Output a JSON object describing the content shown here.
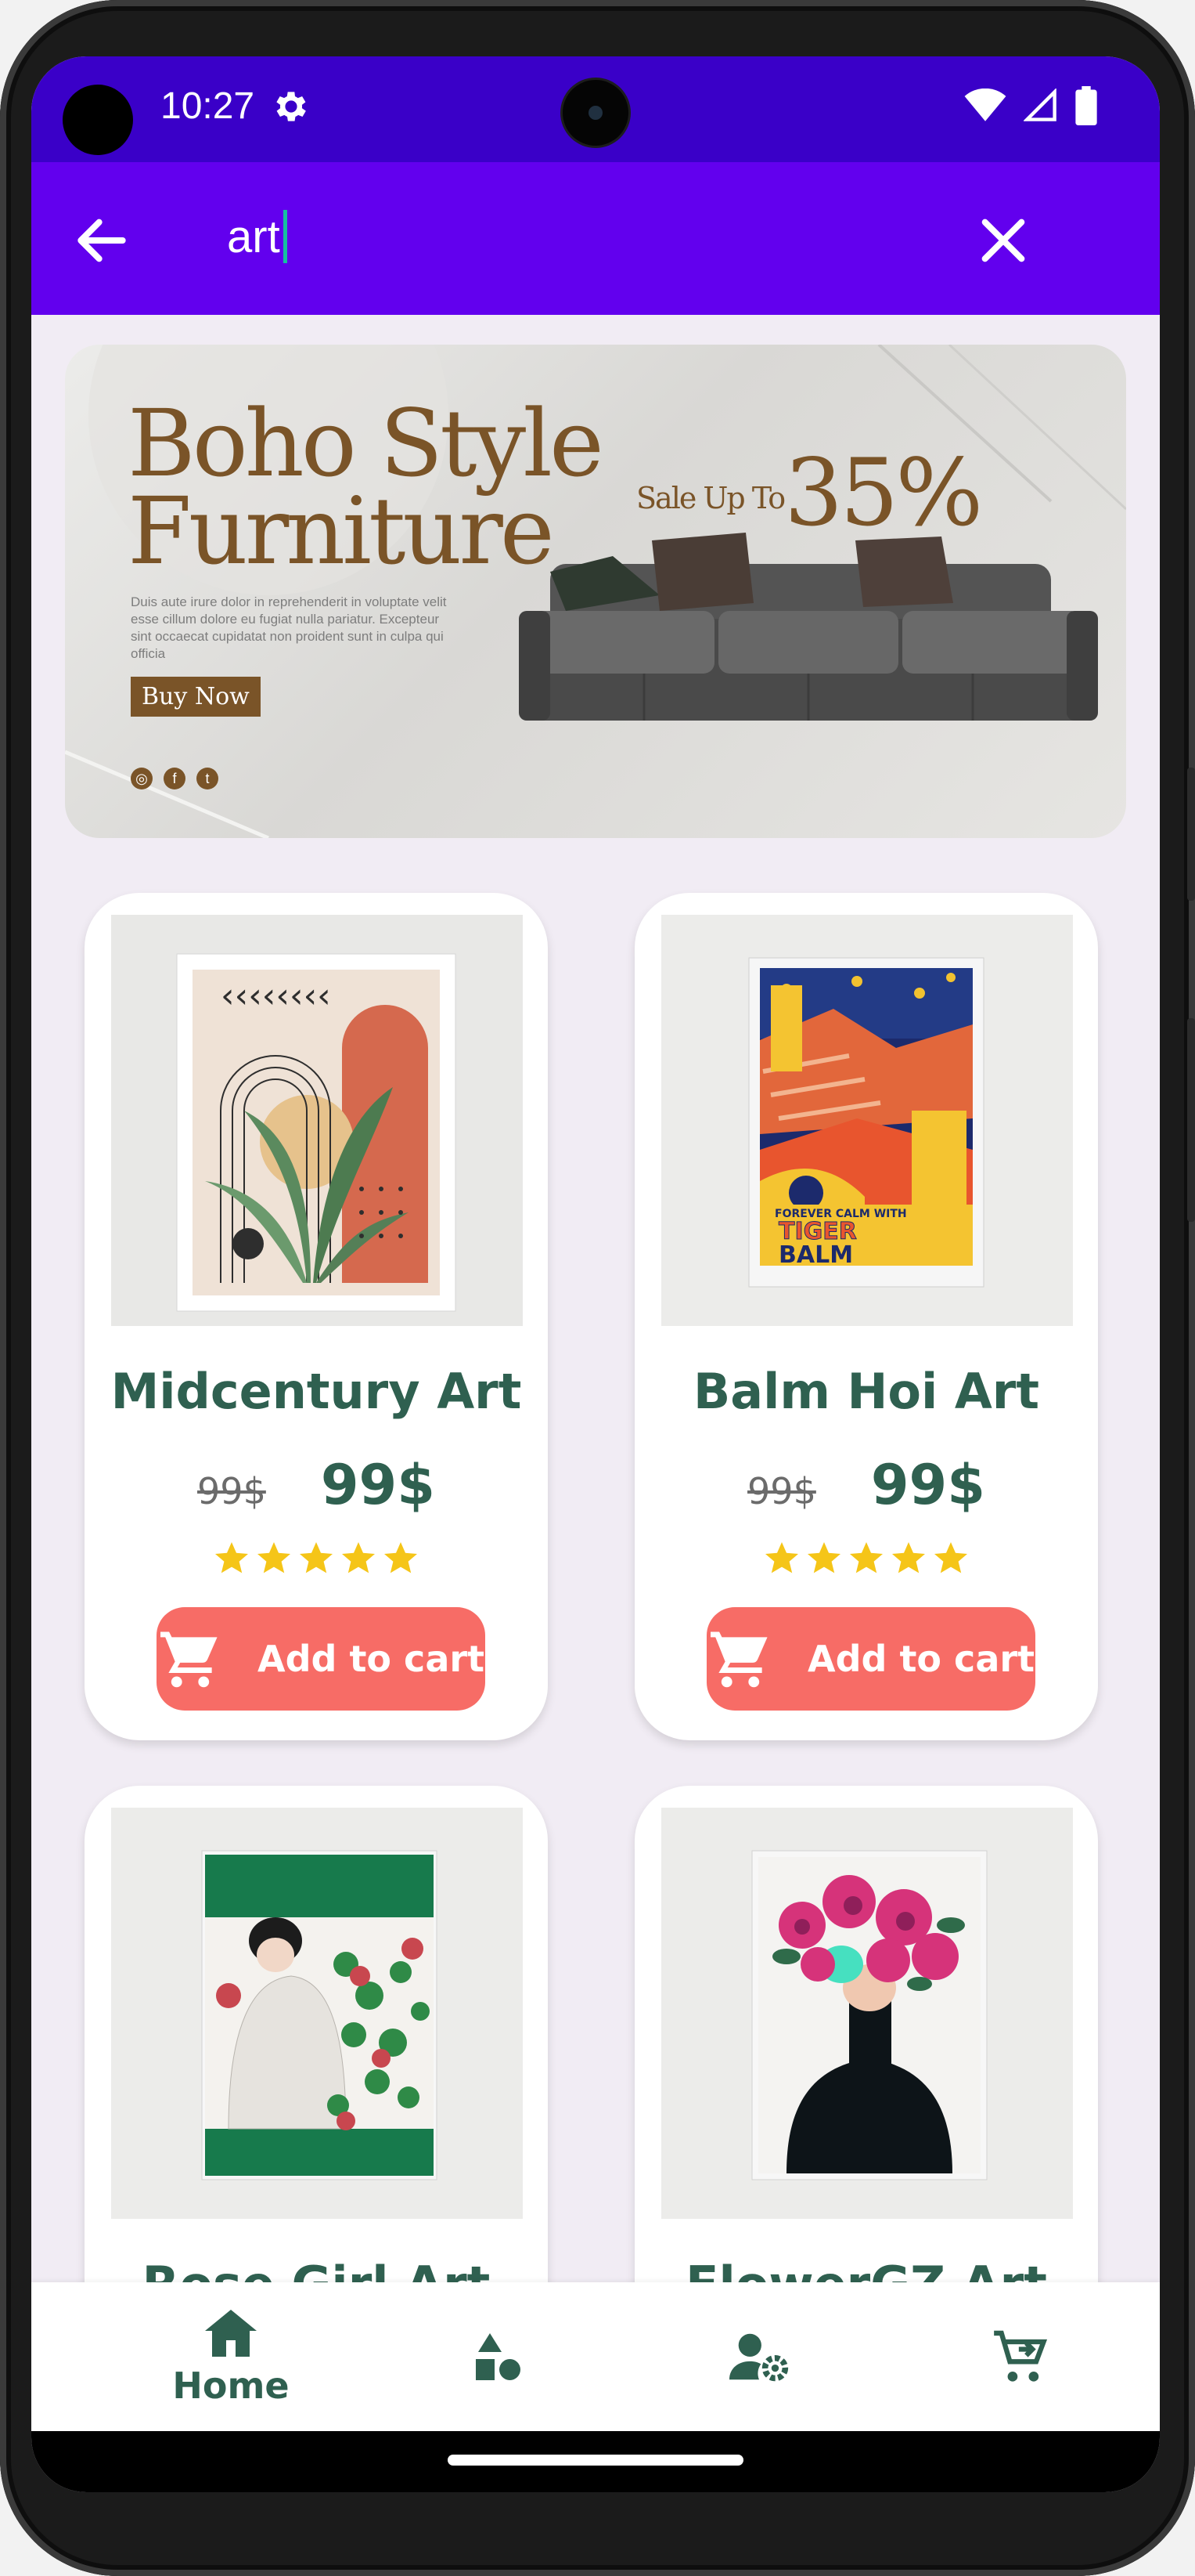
{
  "status_bar": {
    "time": "10:27"
  },
  "search": {
    "query": "art"
  },
  "banner": {
    "title_line1": "Boho Style",
    "title_line2": "Furniture",
    "description": "Duis aute irure dolor in reprehenderit in voluptate velit esse cillum dolore eu fugiat nulla pariatur. Excepteur sint occaecat cupidatat non proident sunt in culpa qui officia",
    "sale_text": "Sale Up To",
    "sale_percent": "35%",
    "cta": "Buy Now"
  },
  "products": [
    {
      "name": "Midcentury Art",
      "old_price": "99$",
      "price": "99$",
      "rating": 5,
      "button": "Add to cart"
    },
    {
      "name": "Balm Hoi Art",
      "old_price": "99$",
      "price": "99$",
      "rating": 5,
      "button": "Add to cart"
    },
    {
      "name": "Rose Girl Art"
    },
    {
      "name": "FlowerGZ Art"
    }
  ],
  "poster": {
    "top_line": "FOREVER CALM WITH",
    "line1": "TIGER",
    "line2": "BALM"
  },
  "bottom_nav": {
    "items": [
      {
        "label": "Home",
        "icon": "home-icon",
        "active": true
      },
      {
        "label": "",
        "icon": "categories-icon"
      },
      {
        "label": "",
        "icon": "user-settings-icon"
      },
      {
        "label": "",
        "icon": "cart-icon"
      }
    ]
  },
  "colors": {
    "status_bar": "#3a00c8",
    "app_bar": "#6200ee",
    "accent_green": "#2f6050",
    "button_coral": "#f76c66",
    "star": "#f5c518"
  }
}
